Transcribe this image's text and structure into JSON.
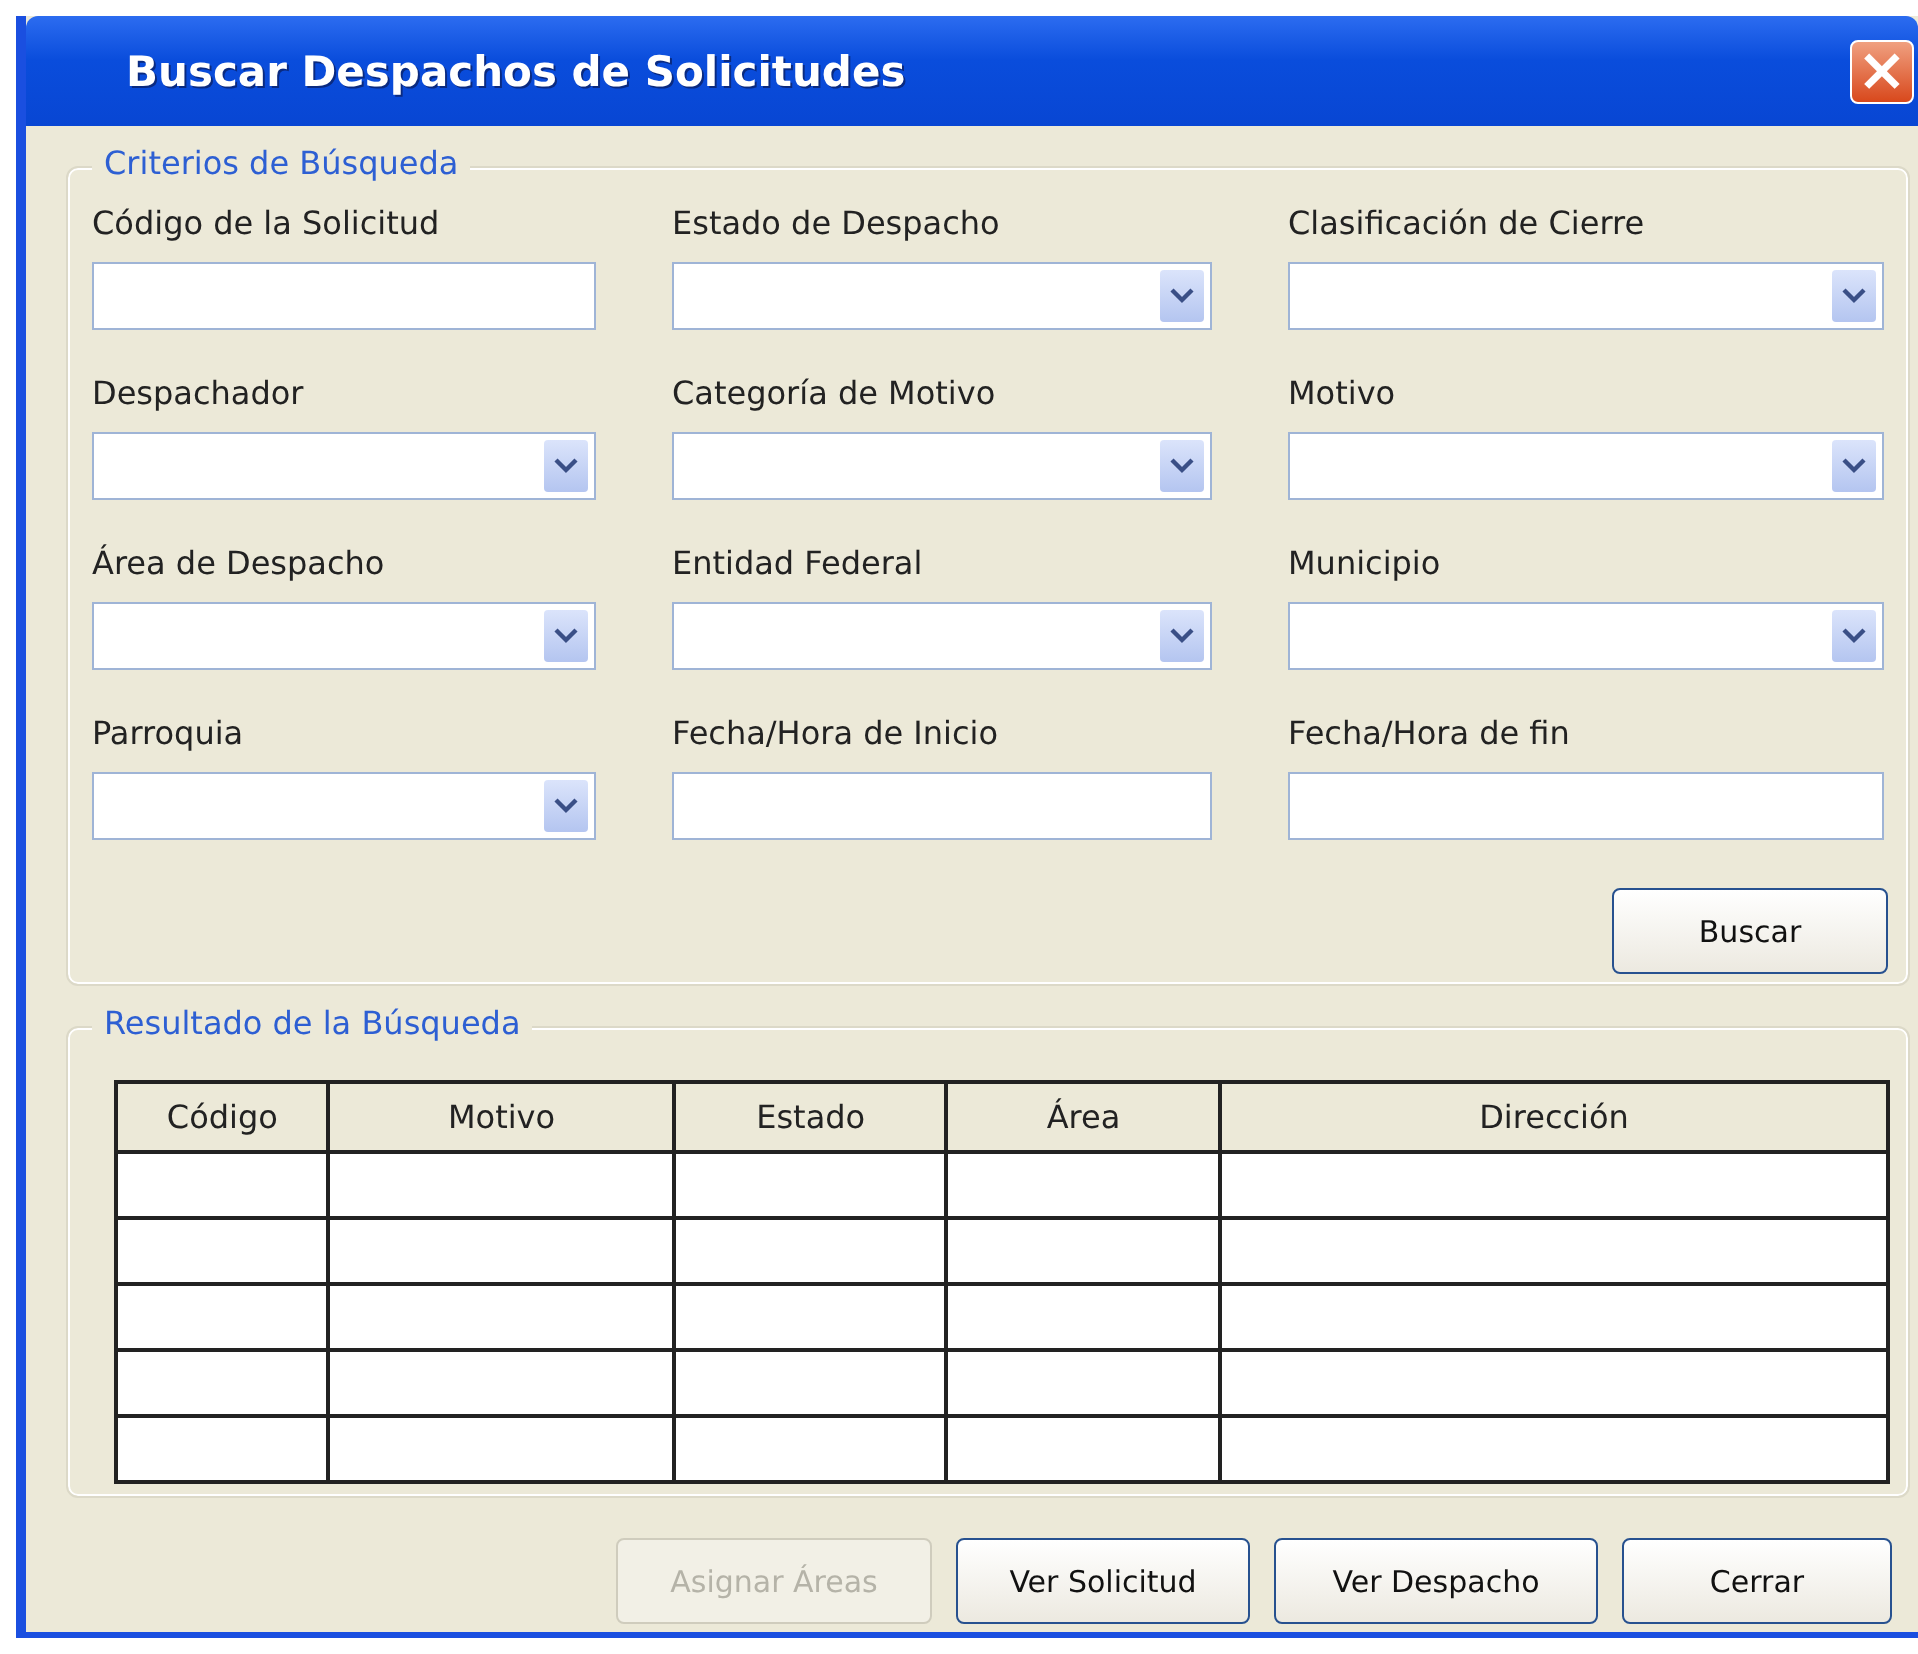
{
  "window": {
    "title": "Buscar Despachos de Solicitudes",
    "close": "×"
  },
  "criteria": {
    "legend": "Criterios de Búsqueda",
    "fields": [
      {
        "label": "Código de la Solicitud",
        "kind": "text"
      },
      {
        "label": "Estado de Despacho",
        "kind": "select"
      },
      {
        "label": "Clasificación de Cierre",
        "kind": "select"
      },
      {
        "label": "Despachador",
        "kind": "select"
      },
      {
        "label": "Categoría de Motivo",
        "kind": "select"
      },
      {
        "label": "Motivo",
        "kind": "select"
      },
      {
        "label": "Área de Despacho",
        "kind": "select"
      },
      {
        "label": "Entidad Federal",
        "kind": "select"
      },
      {
        "label": "Municipio",
        "kind": "select"
      },
      {
        "label": "Parroquia",
        "kind": "select"
      },
      {
        "label": "Fecha/Hora de Inicio",
        "kind": "text"
      },
      {
        "label": "Fecha/Hora de fin",
        "kind": "text"
      }
    ],
    "search_button": {
      "label": "Buscar",
      "disabled": false
    }
  },
  "results": {
    "legend": "Resultado de la Búsqueda",
    "columns": [
      "Código",
      "Motivo",
      "Estado",
      "Área",
      "Dirección"
    ]
  },
  "buttons": [
    {
      "label": "Asignar Áreas",
      "disabled": true
    },
    {
      "label": "Ver Solicitud",
      "disabled": false
    },
    {
      "label": "Ver Despacho",
      "disabled": false
    },
    {
      "label": "Cerrar",
      "disabled": false
    }
  ]
}
